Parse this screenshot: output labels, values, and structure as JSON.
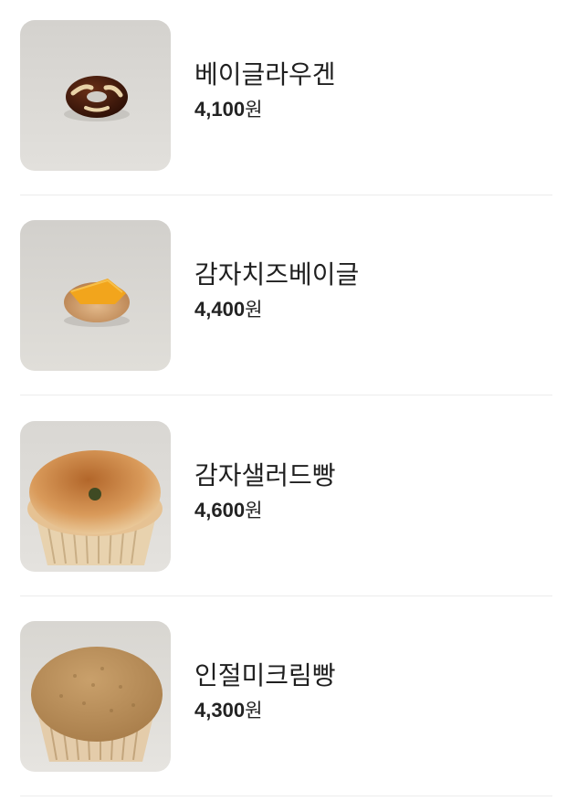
{
  "menu": {
    "items": [
      {
        "name": "베이글라우겐",
        "price": "4,100",
        "currency": "원",
        "image": "pretzel-bagel-image"
      },
      {
        "name": "감자치즈베이글",
        "price": "4,400",
        "currency": "원",
        "image": "cheese-bagel-image"
      },
      {
        "name": "감자샐러드빵",
        "price": "4,600",
        "currency": "원",
        "image": "potato-salad-bread-image"
      },
      {
        "name": "인절미크림빵",
        "price": "4,300",
        "currency": "원",
        "image": "injeolmi-cream-bread-image"
      }
    ]
  },
  "colors": {
    "background": "#ffffff",
    "divider": "#ececec",
    "text": "#222222",
    "photo_backdrop": "#dcdad6"
  }
}
